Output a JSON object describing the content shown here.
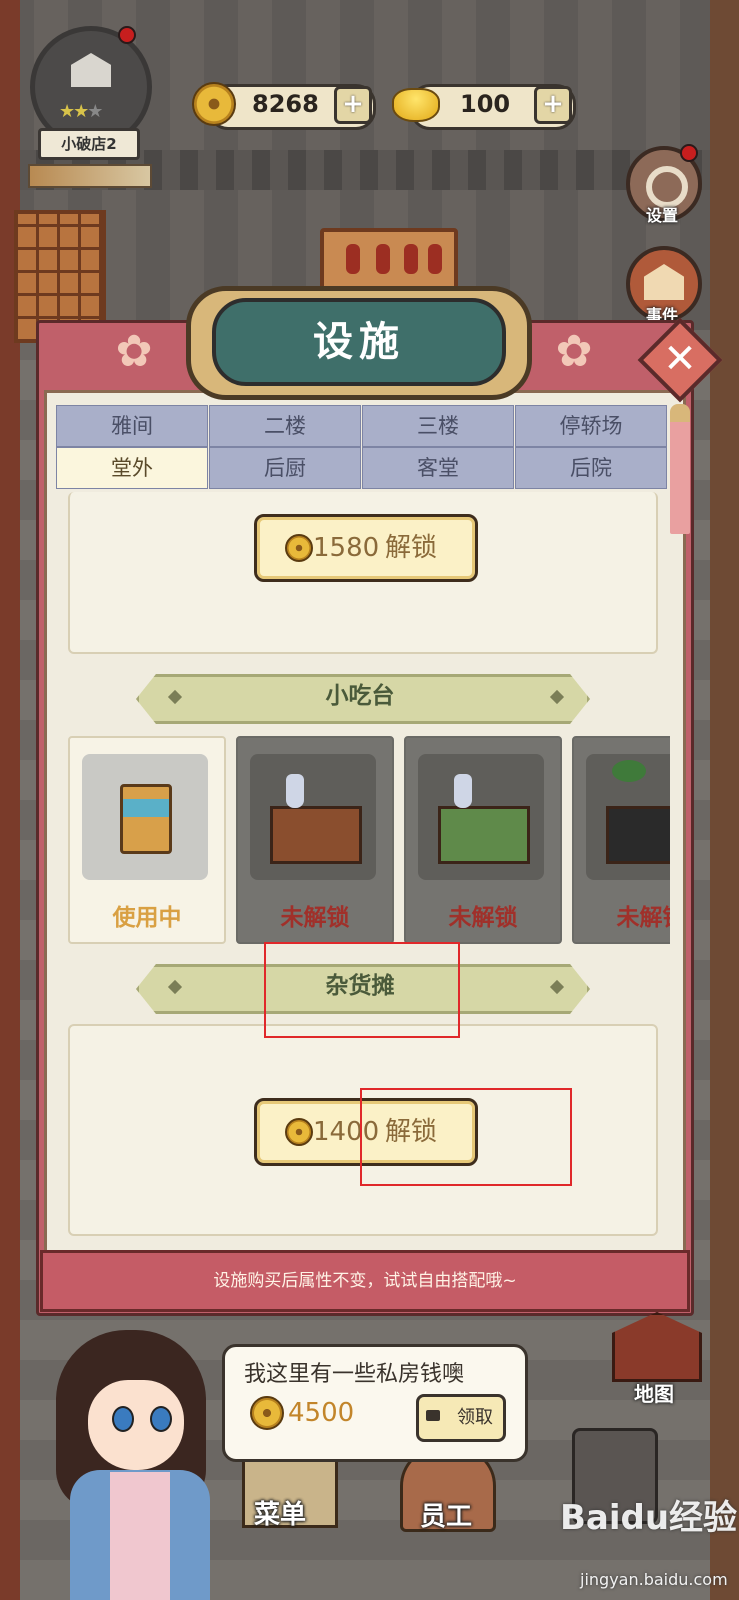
{
  "hud": {
    "shop_name": "小破店2",
    "stars_filled": 2,
    "stars_total": 3,
    "copper_coins": "8268",
    "gold_ingots": "100",
    "plus_symbol": "+"
  },
  "side_buttons": {
    "settings": "设置",
    "events": "事件",
    "map": "地图"
  },
  "panel": {
    "title": "设施",
    "close_symbol": "✕",
    "tabs": [
      {
        "label": "雅间",
        "active": false
      },
      {
        "label": "二楼",
        "active": false
      },
      {
        "label": "三楼",
        "active": false
      },
      {
        "label": "停轿场",
        "active": false
      },
      {
        "label": "堂外",
        "active": true
      },
      {
        "label": "后厨",
        "active": false
      },
      {
        "label": "客堂",
        "active": false
      },
      {
        "label": "后院",
        "active": false
      }
    ],
    "first_unlock": {
      "price": "1580",
      "label": "解锁"
    },
    "snack_section": {
      "title": "小吃台",
      "items": [
        {
          "status": "使用中",
          "state": "in_use"
        },
        {
          "status": "未解锁",
          "state": "locked"
        },
        {
          "status": "未解锁",
          "state": "locked"
        },
        {
          "status": "未解锁",
          "state": "locked"
        }
      ]
    },
    "grocery_section": {
      "title": "杂货摊",
      "unlock": {
        "price": "1400",
        "label": "解锁"
      }
    },
    "footer_tip": "设施购买后属性不变，试试自由搭配哦~"
  },
  "speech": {
    "text": "我这里有一些私房钱噢",
    "amount": "4500",
    "claim_label": "领取"
  },
  "bottom_buttons": {
    "menu": "菜单",
    "staff": "员工"
  },
  "watermark": {
    "main": "Baidu经验",
    "sub": "jingyan.baidu.com"
  },
  "colors": {
    "panel_frame": "#c0606a",
    "title_plate": "#3f6f6a",
    "tab_inactive": "#a9afc9",
    "tab_active": "#fbf6dd",
    "in_use_text": "#d9a043",
    "locked_text": "#a0302a",
    "annotation_red": "#e0282a"
  }
}
